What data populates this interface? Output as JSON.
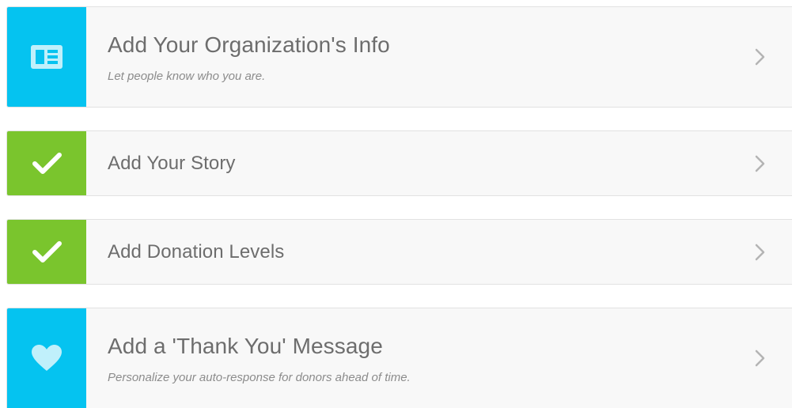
{
  "steps": [
    {
      "title": "Add Your Organization's Info",
      "subtitle": "Let people know who you are.",
      "icon": "id-card-icon",
      "status": "incomplete",
      "color": "#05c3f0"
    },
    {
      "title": "Add Your Story",
      "icon": "checkmark-icon",
      "status": "complete",
      "color": "#7ac52d"
    },
    {
      "title": "Add Donation Levels",
      "icon": "checkmark-icon",
      "status": "complete",
      "color": "#7ac52d"
    },
    {
      "title": "Add a 'Thank You' Message",
      "subtitle": "Personalize your auto-response for donors ahead of time.",
      "icon": "heart-icon",
      "status": "incomplete",
      "color": "#05c3f0"
    }
  ],
  "chevron_icon": "chevron-right-icon"
}
